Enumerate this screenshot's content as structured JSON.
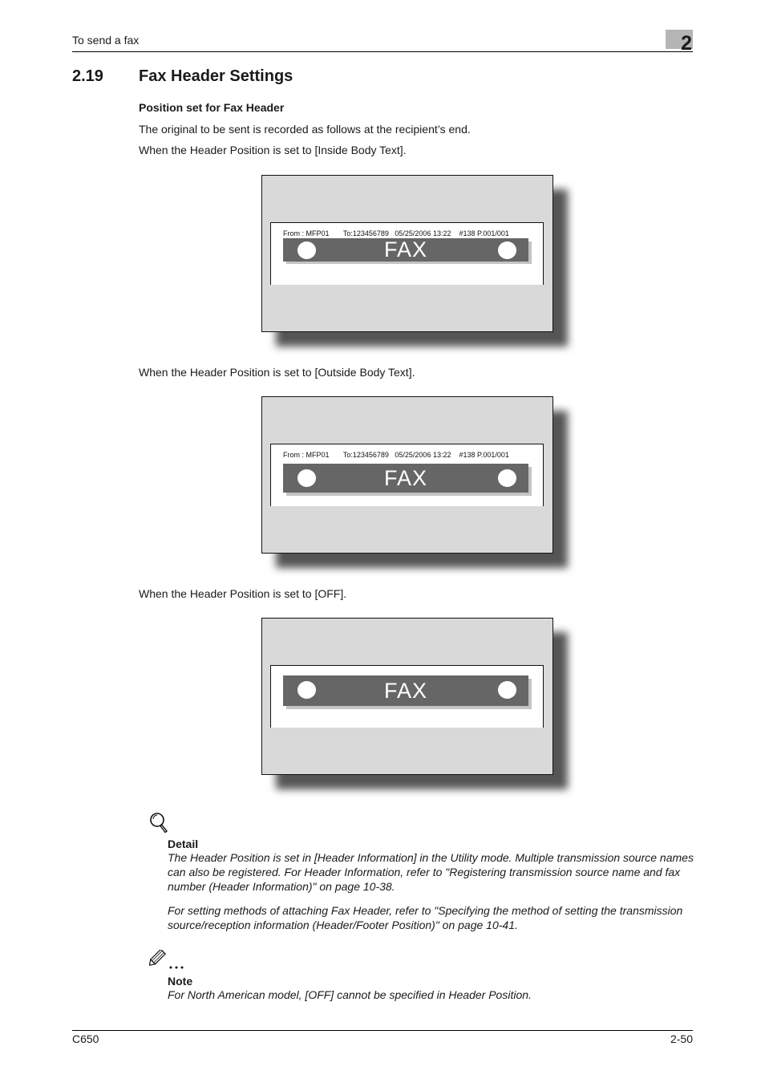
{
  "running_header": {
    "title": "To send a fax",
    "chapter": "2"
  },
  "section": {
    "number": "2.19",
    "title": "Fax Header Settings"
  },
  "subheading": "Position set for Fax Header",
  "intro": "The original to be sent is recorded as follows at the recipient’s end.",
  "illustrations": [
    {
      "caption": "When the Header Position is set to [Inside Body Text].",
      "header_line": "From : MFP01       To:123456789   05/25/2006 13:22    #138 P.001/001",
      "banner_text": "FAX"
    },
    {
      "caption": "When the Header Position is set to [Outside Body Text].",
      "header_line": "From : MFP01       To:123456789   05/25/2006 13:22    #138 P.001/001",
      "banner_text": "FAX"
    },
    {
      "caption": "When the Header Position is set to [OFF].",
      "header_line": "",
      "banner_text": "FAX"
    }
  ],
  "detail": {
    "icon": "magnifier-icon",
    "label": "Detail",
    "paragraphs": [
      "The Header Position is set in [Header Information] in the Utility mode. Multiple transmission source names can also be registered. For Header Information, refer to \"Registering transmission source name and fax number (Header Information)\" on page 10-38.",
      "For setting methods of attaching Fax Header, refer to \"Specifying the method of setting the transmission source/reception information (Header/Footer Position)\" on page 10-41."
    ]
  },
  "note": {
    "icon": "pencil-icon",
    "label": "Note",
    "text": "For North American model, [OFF] cannot be specified in Header Position."
  },
  "footer": {
    "model": "C650",
    "page": "2-50"
  }
}
